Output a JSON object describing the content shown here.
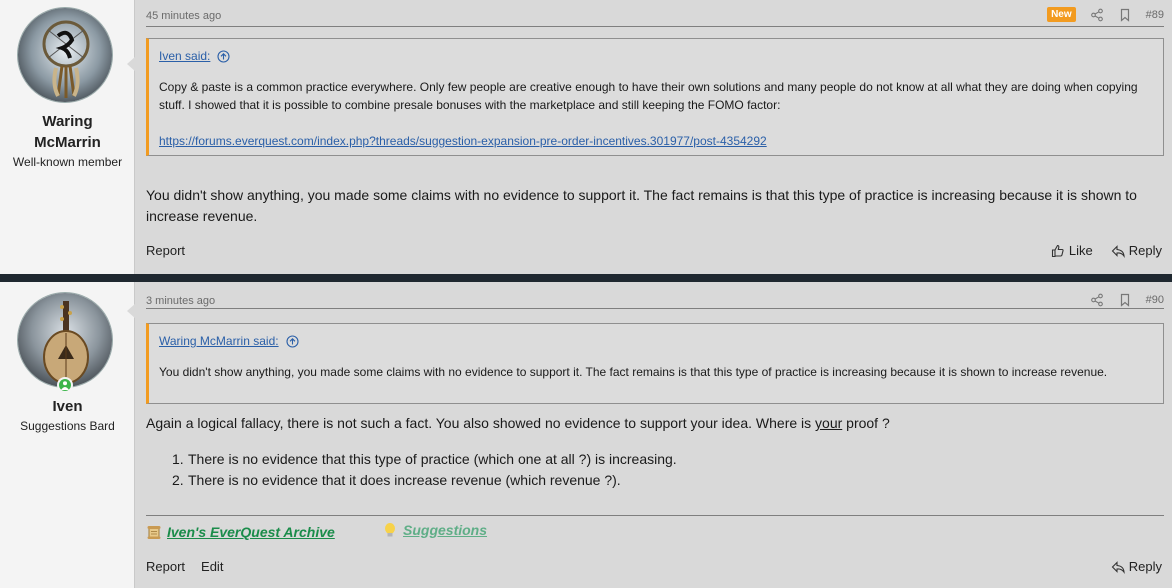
{
  "posts": [
    {
      "user": {
        "name_line1": "Waring",
        "name_line2": "McMarrin",
        "title": "Well-known member"
      },
      "time": "45 minutes ago",
      "badge": "New",
      "post_number": "#89",
      "quote": {
        "author": "Iven said:",
        "text": "Copy & paste is a common practice everywhere. Only few people are creative enough to have their own solutions and many people do not know at all what they are doing when copying stuff. I showed that it is possible to combine presale bonuses with the marketplace and still keeping the FOMO factor:",
        "link": "https://forums.everquest.com/index.php?threads/suggestion-expansion-pre-order-incentives.301977/post-4354292"
      },
      "body": "You didn't show anything, you made some claims with no evidence to support it. The fact remains is that this type of practice is increasing because it is shown to increase revenue.",
      "footer": {
        "report": "Report",
        "like": "Like",
        "reply": "Reply"
      }
    },
    {
      "user": {
        "name": "Iven",
        "title": "Suggestions Bard"
      },
      "time": "3 minutes ago",
      "post_number": "#90",
      "quote": {
        "author": "Waring McMarrin said:",
        "text": "You didn't show anything, you made some claims with no evidence to support it. The fact remains is that this type of practice is increasing because it is shown to increase revenue."
      },
      "body_before": "Again a logical fallacy, there is not such a fact. You also showed no evidence to support your idea. Where is ",
      "body_underlined": "your",
      "body_after": " proof ?",
      "list": [
        {
          "num": "1.",
          "text": "There is no evidence that this type of practice (which one at all ?) is increasing."
        },
        {
          "num": "2.",
          "text": "There is no evidence that it does increase revenue (which revenue ?)."
        }
      ],
      "signature": [
        {
          "text": "Iven's EverQuest Archive",
          "color": "#1a8c4a",
          "icon": "scroll-icon"
        },
        {
          "text": "Suggestions",
          "color": "#5fae87",
          "icon": "lightbulb-icon"
        }
      ],
      "footer": {
        "report": "Report",
        "edit": "Edit",
        "reply": "Reply"
      }
    }
  ],
  "colors": {
    "accent": "#f29b20",
    "link": "#2a5fa8",
    "separator": "#1f2830",
    "online": "#3bb54a"
  }
}
